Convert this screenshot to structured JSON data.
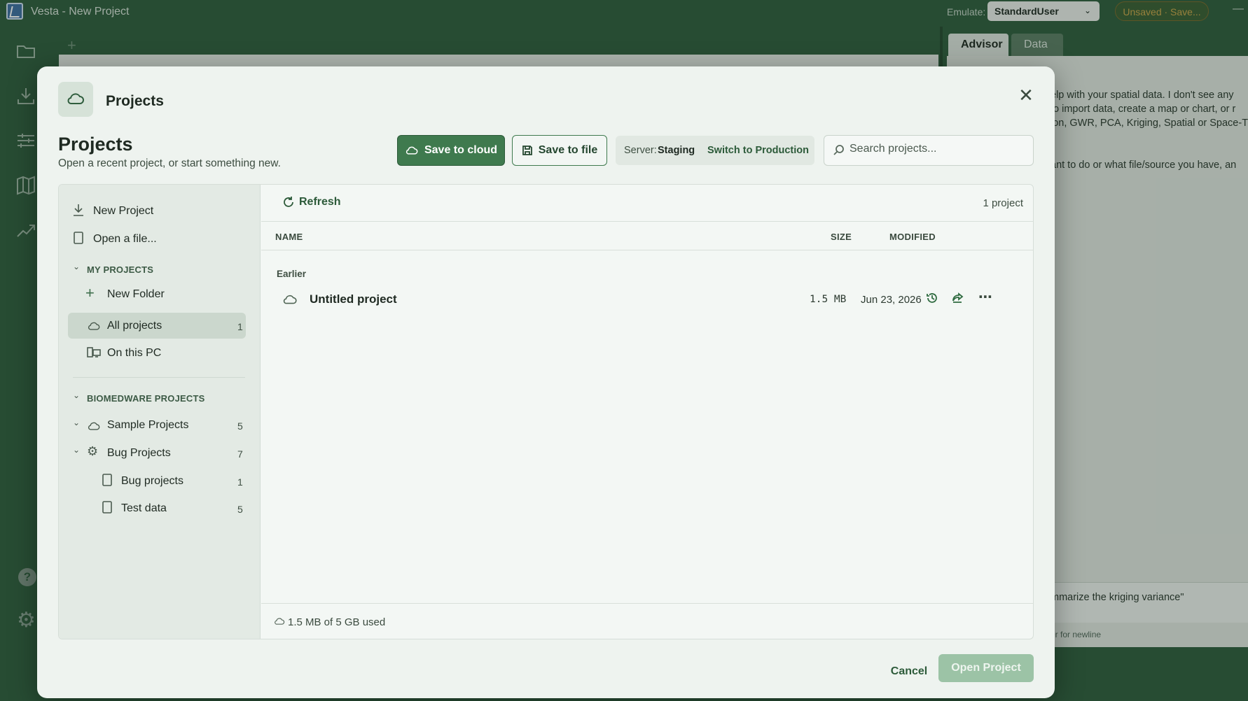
{
  "app": {
    "title": "Vesta - New Project",
    "emulate_label": "Emulate:",
    "emulate_value": "StandardUser",
    "unsaved_label": "Unsaved · Save..."
  },
  "background": {
    "right_tabs": [
      "Advisor",
      "Data"
    ],
    "advisor_lines": [
      "elp with your spatial data. I don't see any",
      "to import data, create a map or chart, or r",
      "ion, GWR, PCA, Kriging, Spatial or Space-T",
      "ant to do or what file/source you have, an"
    ],
    "prompt_text": "mmarize the kriging variance\"",
    "prompt_hint": "er for newline"
  },
  "dialog": {
    "header_title": "Projects",
    "heading": "Projects",
    "subtitle": "Open a recent project, or start something new.",
    "save_cloud_label": "Save to cloud",
    "save_file_label": "Save to file",
    "server_label": "Server:",
    "server_value": "Staging",
    "server_switch": "Switch to Production",
    "search_placeholder": "Search projects...",
    "cancel_label": "Cancel",
    "open_label": "Open Project"
  },
  "sidebar": {
    "new_project": "New Project",
    "open_file": "Open a file...",
    "my_projects_section": "MY PROJECTS",
    "new_folder": "New Folder",
    "all_projects": {
      "label": "All projects",
      "count": "1"
    },
    "on_this_pc": "On this PC",
    "biomedware_section": "BIOMEDWARE PROJECTS",
    "sample_projects": {
      "label": "Sample Projects",
      "count": "5"
    },
    "bug_projects": {
      "label": "Bug Projects",
      "count": "7"
    },
    "bug_projects_sub": {
      "label": "Bug projects",
      "count": "1"
    },
    "test_data": {
      "label": "Test data",
      "count": "5"
    }
  },
  "list": {
    "refresh_label": "Refresh",
    "count_text": "1 project",
    "columns": {
      "name": "NAME",
      "size": "SIZE",
      "modified": "MODIFIED"
    },
    "group_label": "Earlier",
    "rows": [
      {
        "name": "Untitled project",
        "size": "1.5 MB",
        "modified": "Jun 23, 2026"
      }
    ],
    "storage_text": "1.5 MB of 5 GB used"
  },
  "colors": {
    "brand_green": "#2f5d3d",
    "accent_green": "#3f7a4e",
    "disabled_green": "#9cc3a6"
  }
}
